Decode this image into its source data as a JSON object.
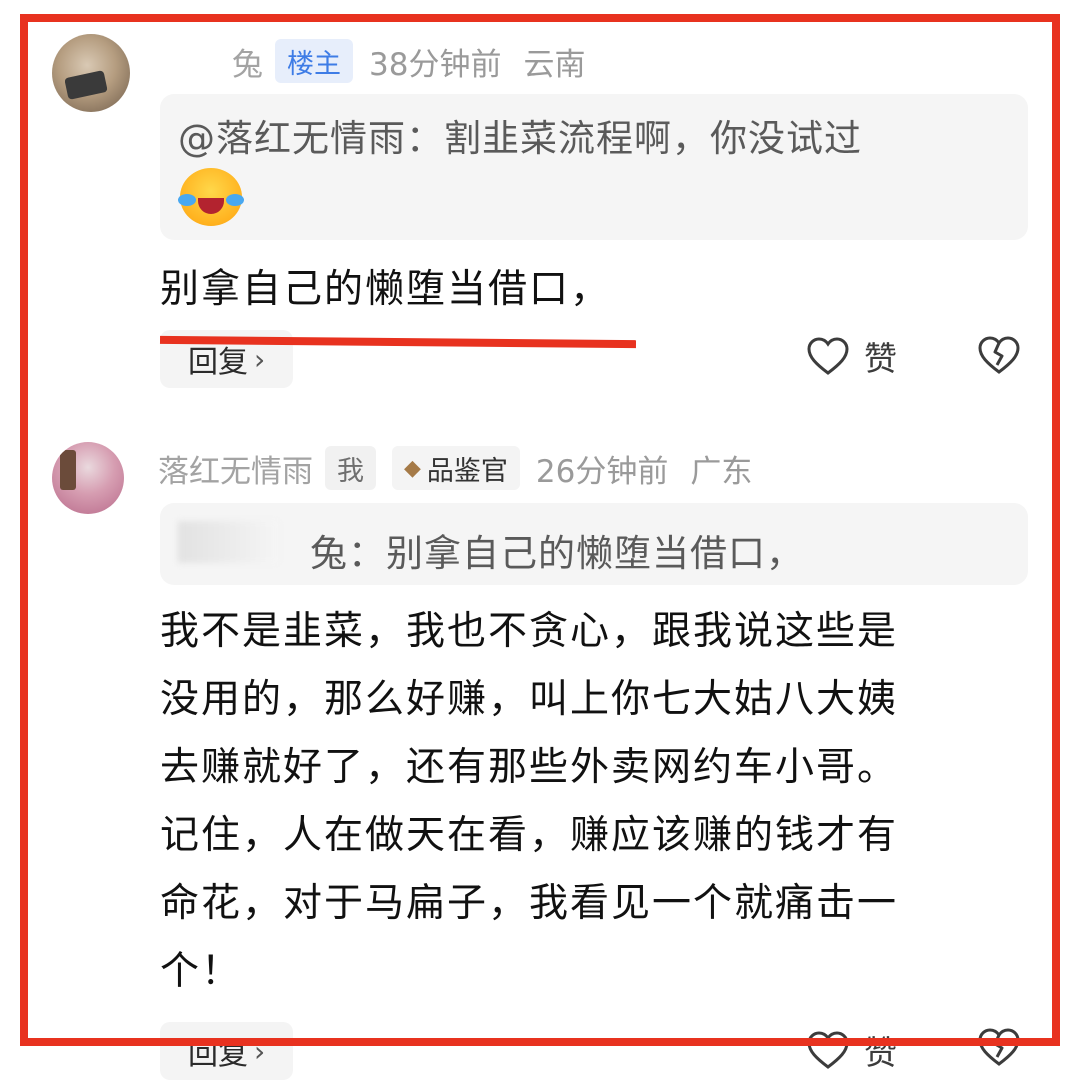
{
  "comments": [
    {
      "username": "兔",
      "badge": "楼主",
      "time": "38分钟前",
      "location": "云南",
      "quote_text": "@落红无情雨：割韭菜流程啊，你没试过",
      "quote_emoji": "laughing-crying-emoji",
      "text": "别拿自己的懒堕当借口，",
      "reply_label": "回复",
      "like_label": "赞"
    },
    {
      "username": "落红无情雨",
      "badge_me": "我",
      "badge_title": "品鉴官",
      "time": "26分钟前",
      "location": "广东",
      "quote_text": "兔：别拿自己的懒堕当借口，",
      "text_lines": [
        "我不是韭菜，我也不贪心，跟我说这些是",
        "没用的，那么好赚，叫上你七大姑八大姨",
        "去赚就好了，还有那些外卖网约车小哥。",
        "记住，人在做天在看，赚应该赚的钱才有",
        "命花，对于马扁子，我看见一个就痛击一",
        "个！"
      ],
      "reply_label": "回复",
      "like_label": "赞"
    }
  ],
  "icons": {
    "like": "heart-outline-icon",
    "dislike": "broken-heart-icon",
    "title_badge": "diamond-icon",
    "reply": "chevron-right-icon"
  },
  "colors": {
    "highlight_red": "#e8321f",
    "host_badge_blue": "#3e7ce6",
    "meta_gray": "#9a9a9a"
  }
}
